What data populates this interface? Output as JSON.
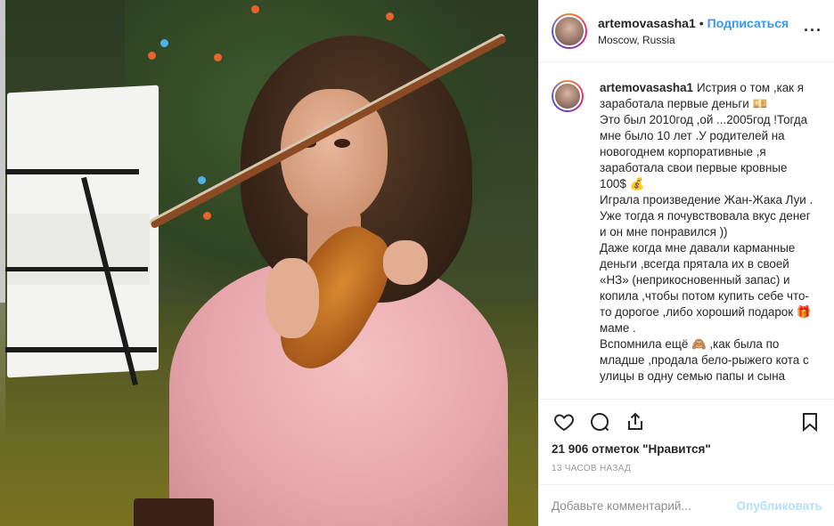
{
  "post": {
    "username": "artemovasasha1",
    "separator": "•",
    "follow_label": "Подписаться",
    "location": "Moscow, Russia",
    "more_icon": "···"
  },
  "caption": {
    "username": "artemovasasha1",
    "lines": [
      "Истрия о том ,как я заработала первые деньги 💴",
      "Это был 2010год ,ой ...2005год !Тогда мне было 10 лет .У родителей на новогоднем корпоративные ,я заработала свои первые кровные 100$ 💰",
      "Играла произведение Жан-Жака Луи .",
      "Уже тогда я почувствовала вкус денег и он мне понравился ))",
      "Даже когда мне давали карманные деньги ,всегда прятала их в своей «НЗ» (неприкосновенный запас) и копила ,чтобы потом купить себе что-то дорогое ,либо хороший подарок 🎁 маме .",
      "Вспомнила ещё 🙈 ,как была по младше ,продала бело-рыжего кота с улицы в одну семью папы и сына"
    ]
  },
  "actions": {
    "like_icon": "heart-icon",
    "comment_icon": "comment-icon",
    "share_icon": "share-icon",
    "save_icon": "bookmark-icon"
  },
  "likes": "21 906 отметок \"Нравится\"",
  "timestamp": "13 ЧАСОВ НАЗАД",
  "comment": {
    "placeholder": "Добавьте комментарий...",
    "publish_label": "Опубликовать"
  },
  "colors": {
    "link": "#3897f0",
    "publish_disabled": "#b2dffc",
    "muted": "#999999"
  }
}
